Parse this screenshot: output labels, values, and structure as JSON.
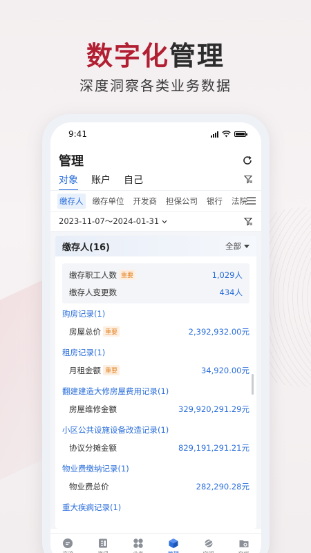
{
  "promo": {
    "headline_red": "数字化",
    "headline_dark": "管理",
    "subline": "深度洞察各类业务数据"
  },
  "status": {
    "time": "9:41"
  },
  "page": {
    "title": "管理"
  },
  "tabs": [
    {
      "label": "对象",
      "active": true
    },
    {
      "label": "账户",
      "active": false
    },
    {
      "label": "自己",
      "active": false
    }
  ],
  "subtabs": [
    {
      "label": "缴存人",
      "active": true
    },
    {
      "label": "缴存单位",
      "active": false
    },
    {
      "label": "开发商",
      "active": false
    },
    {
      "label": "担保公司",
      "active": false
    },
    {
      "label": "银行",
      "active": false
    },
    {
      "label": "法院",
      "active": false
    }
  ],
  "date_range": "2023-11-07～2024-01-31",
  "card": {
    "title": "缴存人(16)",
    "filter_label": "全部",
    "tag_label": "重要",
    "summary": [
      {
        "label": "缴存职工人数",
        "important": true,
        "value": "1,029人"
      },
      {
        "label": "缴存人变更数",
        "important": false,
        "value": "434人"
      }
    ],
    "sections": [
      {
        "title": "购房记录(1)",
        "row_label": "房屋总价",
        "important": true,
        "value": "2,392,932.00元"
      },
      {
        "title": "租房记录(1)",
        "row_label": "月租金额",
        "important": true,
        "value": "34,920.00元"
      },
      {
        "title": "翻建建造大修房屋费用记录(1)",
        "row_label": "房屋维修金额",
        "important": false,
        "value": "329,920,291.29元"
      },
      {
        "title": "小区公共设施设备改造记录(1)",
        "row_label": "协议分摊金额",
        "important": false,
        "value": "829,191,291.21元"
      },
      {
        "title": "物业费缴纳记录(1)",
        "row_label": "物业费总价",
        "important": false,
        "value": "282,290.28元"
      },
      {
        "title": "重大疾病记录(1)",
        "row_label": "",
        "important": false,
        "value": ""
      }
    ]
  },
  "bottom_nav": [
    {
      "label": "交流",
      "icon": "chat-icon",
      "active": false
    },
    {
      "label": "资讯",
      "icon": "news-icon",
      "active": false
    },
    {
      "label": "业务",
      "icon": "grid-icon",
      "active": false
    },
    {
      "label": "管理",
      "icon": "cube-icon",
      "active": true
    },
    {
      "label": "空间",
      "icon": "planet-icon",
      "active": false
    },
    {
      "label": "文档",
      "icon": "folder-icon",
      "active": false
    }
  ],
  "colors": {
    "accent": "#2a6edb",
    "brand_red": "#b21f33",
    "tag_orange": "#e5862b"
  }
}
